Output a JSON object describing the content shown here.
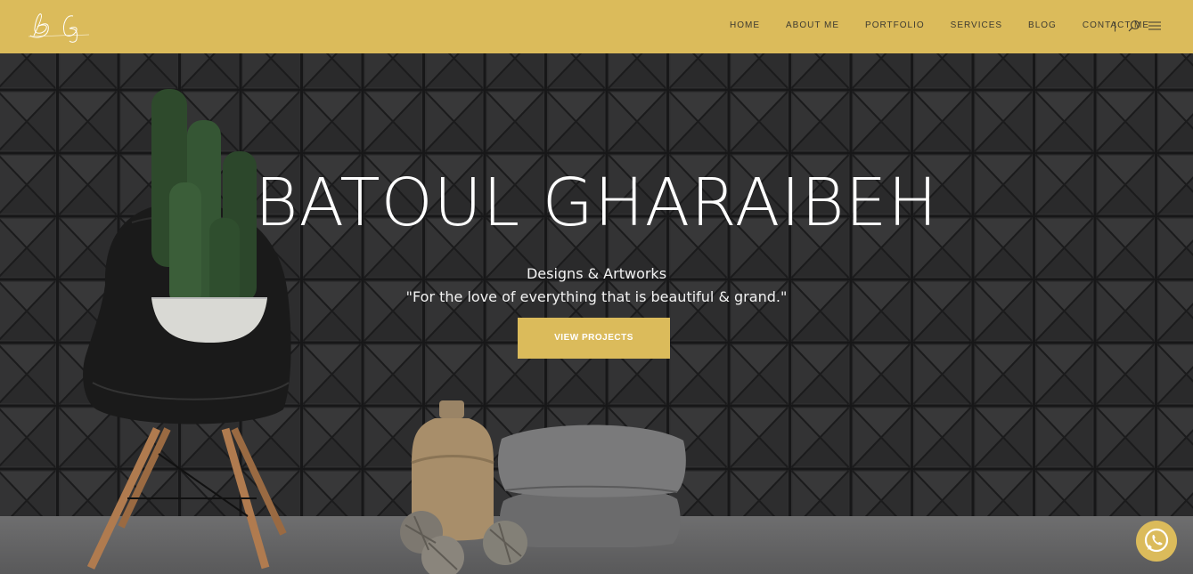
{
  "header": {
    "logo_text": "B G",
    "nav": [
      "HOME",
      "ABOUT ME",
      "PORTFOLIO",
      "SERVICES",
      "BLOG",
      "CONTACT ME"
    ],
    "divider": "|",
    "icons": [
      "search-icon",
      "menu-icon"
    ],
    "background": "#dbbb5b"
  },
  "hero": {
    "title": "BATOUL GHARAIBEH",
    "subtitle": "Designs & Artworks",
    "quote": "\"For the love of everything that is beautiful & grand.\"",
    "cta_label": "VIEW PROJECTS",
    "accent": "#dbbb5b"
  },
  "floating": {
    "icon": "whatsapp-icon"
  }
}
